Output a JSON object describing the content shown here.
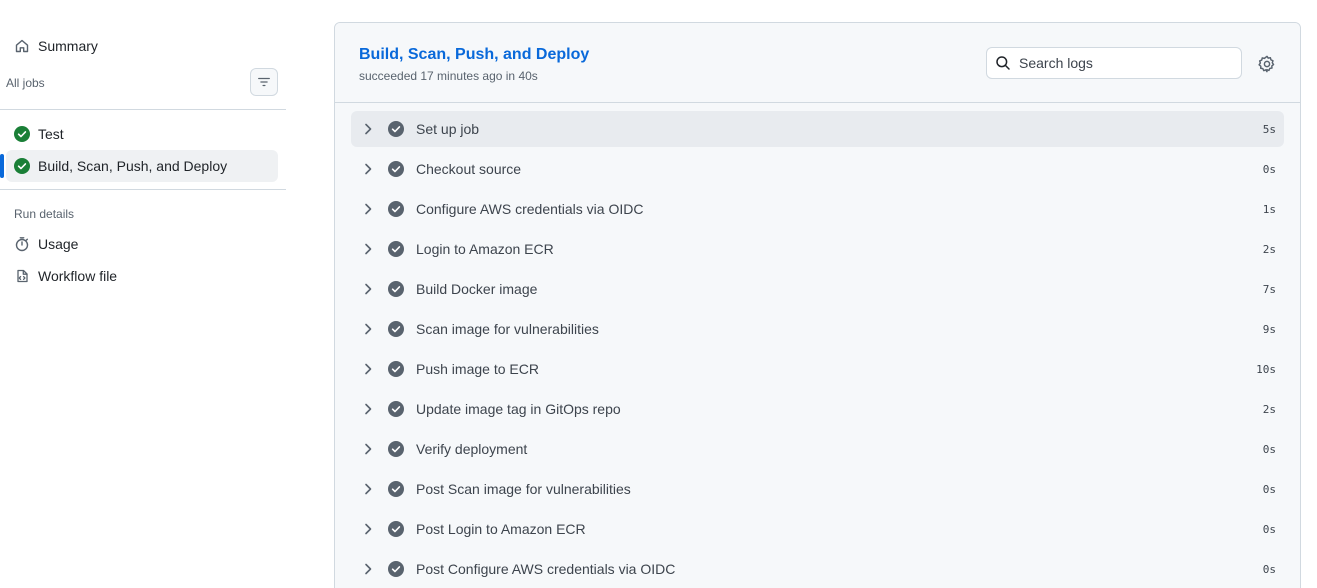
{
  "sidebar": {
    "summary_label": "Summary",
    "all_jobs_label": "All jobs",
    "jobs": [
      {
        "label": "Test",
        "status": "success",
        "active": false
      },
      {
        "label": "Build, Scan, Push, and Deploy",
        "status": "success",
        "active": true
      }
    ],
    "run_details_label": "Run details",
    "usage_label": "Usage",
    "workflow_file_label": "Workflow file"
  },
  "job": {
    "title": "Build, Scan, Push, and Deploy",
    "subtitle": "succeeded 17 minutes ago in 40s",
    "search_placeholder": "Search logs"
  },
  "steps": [
    {
      "name": "Set up job",
      "duration": "5s"
    },
    {
      "name": "Checkout source",
      "duration": "0s"
    },
    {
      "name": "Configure AWS credentials via OIDC",
      "duration": "1s"
    },
    {
      "name": "Login to Amazon ECR",
      "duration": "2s"
    },
    {
      "name": "Build Docker image",
      "duration": "7s"
    },
    {
      "name": "Scan image for vulnerabilities",
      "duration": "9s"
    },
    {
      "name": "Push image to ECR",
      "duration": "10s"
    },
    {
      "name": "Update image tag in GitOps repo",
      "duration": "2s"
    },
    {
      "name": "Verify deployment",
      "duration": "0s"
    },
    {
      "name": "Post Scan image for vulnerabilities",
      "duration": "0s"
    },
    {
      "name": "Post Login to Amazon ECR",
      "duration": "0s"
    },
    {
      "name": "Post Configure AWS credentials via OIDC",
      "duration": "0s"
    }
  ],
  "colors": {
    "accent": "#0969da",
    "success": "#1a7f37",
    "step_check": "#59636e"
  },
  "icons": {
    "summary": "home-icon",
    "filter": "filter-icon",
    "job_status": "check-circle-fill-icon",
    "usage": "stopwatch-icon",
    "workflow_file": "file-code-icon",
    "search": "search-icon",
    "settings": "gear-icon",
    "step_expand": "chevron-right-icon",
    "step_status": "check-circle-fill-icon"
  }
}
